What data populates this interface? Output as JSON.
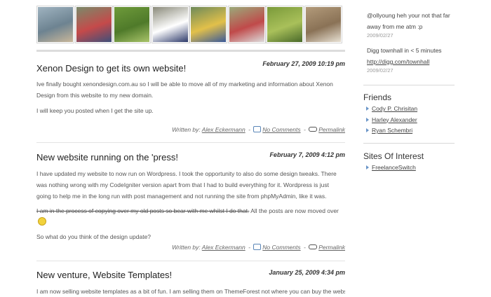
{
  "thumbnails": [
    {
      "name": "beach-photo",
      "colors": [
        "#9fb3c0",
        "#6d8391",
        "#c9b79a"
      ]
    },
    {
      "name": "cyclists-photo-1",
      "colors": [
        "#7a8a6a",
        "#c54a4a",
        "#3d4f7a"
      ]
    },
    {
      "name": "vine-leaves-photo",
      "colors": [
        "#6e9a3a",
        "#4f7a2a",
        "#a9c46a"
      ]
    },
    {
      "name": "cyclists-photo-2",
      "colors": [
        "#8a8a7a",
        "#ffffff",
        "#2d3a6a"
      ]
    },
    {
      "name": "cyclists-photo-3",
      "colors": [
        "#6e8a5a",
        "#e2c04a",
        "#3a5a9a"
      ]
    },
    {
      "name": "peloton-photo",
      "colors": [
        "#9aaa7a",
        "#c04a4a",
        "#dcdcdc"
      ]
    },
    {
      "name": "grapes-photo",
      "colors": [
        "#7a9a3a",
        "#a9c05a",
        "#4a6a2a"
      ]
    },
    {
      "name": "sand-shell-photo",
      "colors": [
        "#b29a7a",
        "#8a7256",
        "#e8e1d4"
      ]
    }
  ],
  "posts": [
    {
      "date": "February 27, 2009 10:19 pm",
      "title": "Xenon Design to get its own website!",
      "paragraphs": [
        "Ive finally bought xenondesign.com.au so I will be able to move all of my marketing and information about Xenon Design from this website to my new domain.",
        "I will keep you posted when I get the site up."
      ],
      "written_by_label": "Written by:",
      "author": "Alex Eckermann",
      "comments_label": "No Comments",
      "permalink_label": "Permalink"
    },
    {
      "date": "February 7, 2009 4:12 pm",
      "title": "New website running on the 'press!",
      "paragraphs": [
        "I have updated my website to now run on Wordpress. I took the opportunity to also do some design tweaks. There was nothing wrong with my CodeIgniter version apart from that I had to build everything for it. Wordpress is just going to help me in the long run with post management and not running the site from phpMyAdmin, like it was."
      ],
      "struck_text": "I am in the process of copying over my old posts so bear with me whilst I do that.",
      "after_struck_text": " All the posts are now moved over",
      "question": "So what do you think of the design update?",
      "written_by_label": "Written by:",
      "author": "Alex Eckermann",
      "comments_label": "No Comments",
      "permalink_label": "Permalink"
    },
    {
      "date": "January 25, 2009 4:34 pm",
      "title": "New venture, Website Templates!",
      "paragraphs": [
        "I am now selling website templates as a bit of fun. I am selling them on ThemeForest not where you can buy the website"
      ]
    }
  ],
  "sidebar": {
    "tweets": [
      {
        "text": "@ollyoung heh your not that far away from me atm :p",
        "stamp": "2009/02/27"
      },
      {
        "text": "Digg townhall in < 5 minutes",
        "link": "http://digg.com/townhall",
        "stamp": "2009/02/27"
      }
    ],
    "friends_title": "Friends",
    "friends": [
      "Cody P. Chrisitan",
      "Harley Alexander",
      "Ryan Schembri"
    ],
    "sites_title": "Sites Of Interest",
    "sites": [
      "FreelanceSwitch"
    ]
  }
}
